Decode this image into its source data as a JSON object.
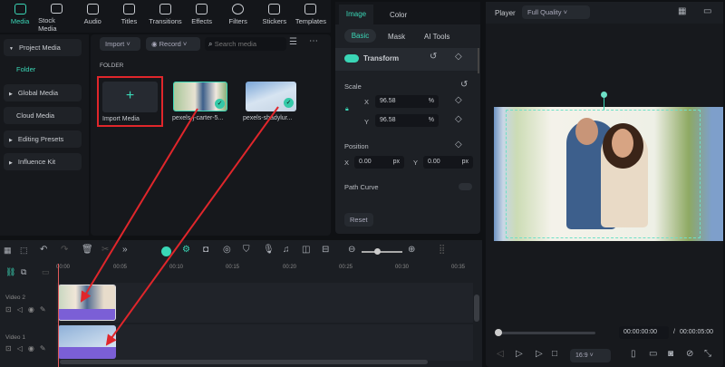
{
  "toolbar": {
    "tabs": [
      {
        "label": "Media",
        "icon": "media-icon"
      },
      {
        "label": "Stock Media",
        "icon": "stock-media-icon"
      },
      {
        "label": "Audio",
        "icon": "audio-icon"
      },
      {
        "label": "Titles",
        "icon": "titles-icon"
      },
      {
        "label": "Transitions",
        "icon": "transitions-icon"
      },
      {
        "label": "Effects",
        "icon": "effects-icon"
      },
      {
        "label": "Filters",
        "icon": "filters-icon"
      },
      {
        "label": "Stickers",
        "icon": "stickers-icon"
      },
      {
        "label": "Templates",
        "icon": "templates-icon"
      }
    ]
  },
  "sidebar": {
    "items": [
      {
        "label": "Project Media"
      },
      {
        "label": "Folder"
      },
      {
        "label": "Global Media"
      },
      {
        "label": "Cloud Media"
      },
      {
        "label": "Editing Presets"
      },
      {
        "label": "Influence Kit"
      }
    ]
  },
  "media": {
    "import": "Import",
    "record": "Record",
    "search_placeholder": "Search media",
    "folder_label": "FOLDER",
    "import_media": "Import Media",
    "items": [
      {
        "name": "pexels-j-carter-5..."
      },
      {
        "name": "pexels-shadylur..."
      }
    ]
  },
  "props": {
    "tabs": [
      "Image",
      "Color"
    ],
    "subtabs": [
      "Basic",
      "Mask",
      "AI Tools"
    ],
    "transform": "Transform",
    "scale": "Scale",
    "x_label": "X",
    "y_label": "Y",
    "scale_x": "96.58",
    "scale_y": "96.58",
    "pct": "%",
    "position": "Position",
    "pos_x": "0.00",
    "pos_y": "0.00",
    "px": "px",
    "path_curve": "Path Curve",
    "reset": "Reset"
  },
  "player": {
    "label": "Player",
    "quality": "Full Quality",
    "current": "00:00:00:00",
    "sep": "/",
    "total": "00:00:05:00",
    "ratio": "16:9"
  },
  "timeline": {
    "ticks": [
      "00:00",
      "00:05",
      "00:10",
      "00:15",
      "00:20",
      "00:25",
      "00:30",
      "00:35"
    ],
    "tracks": [
      {
        "name": "Video 2"
      },
      {
        "name": "Video 1"
      }
    ]
  },
  "colors": {
    "accent": "#3ad6b6",
    "annotation": "#e0262b"
  }
}
